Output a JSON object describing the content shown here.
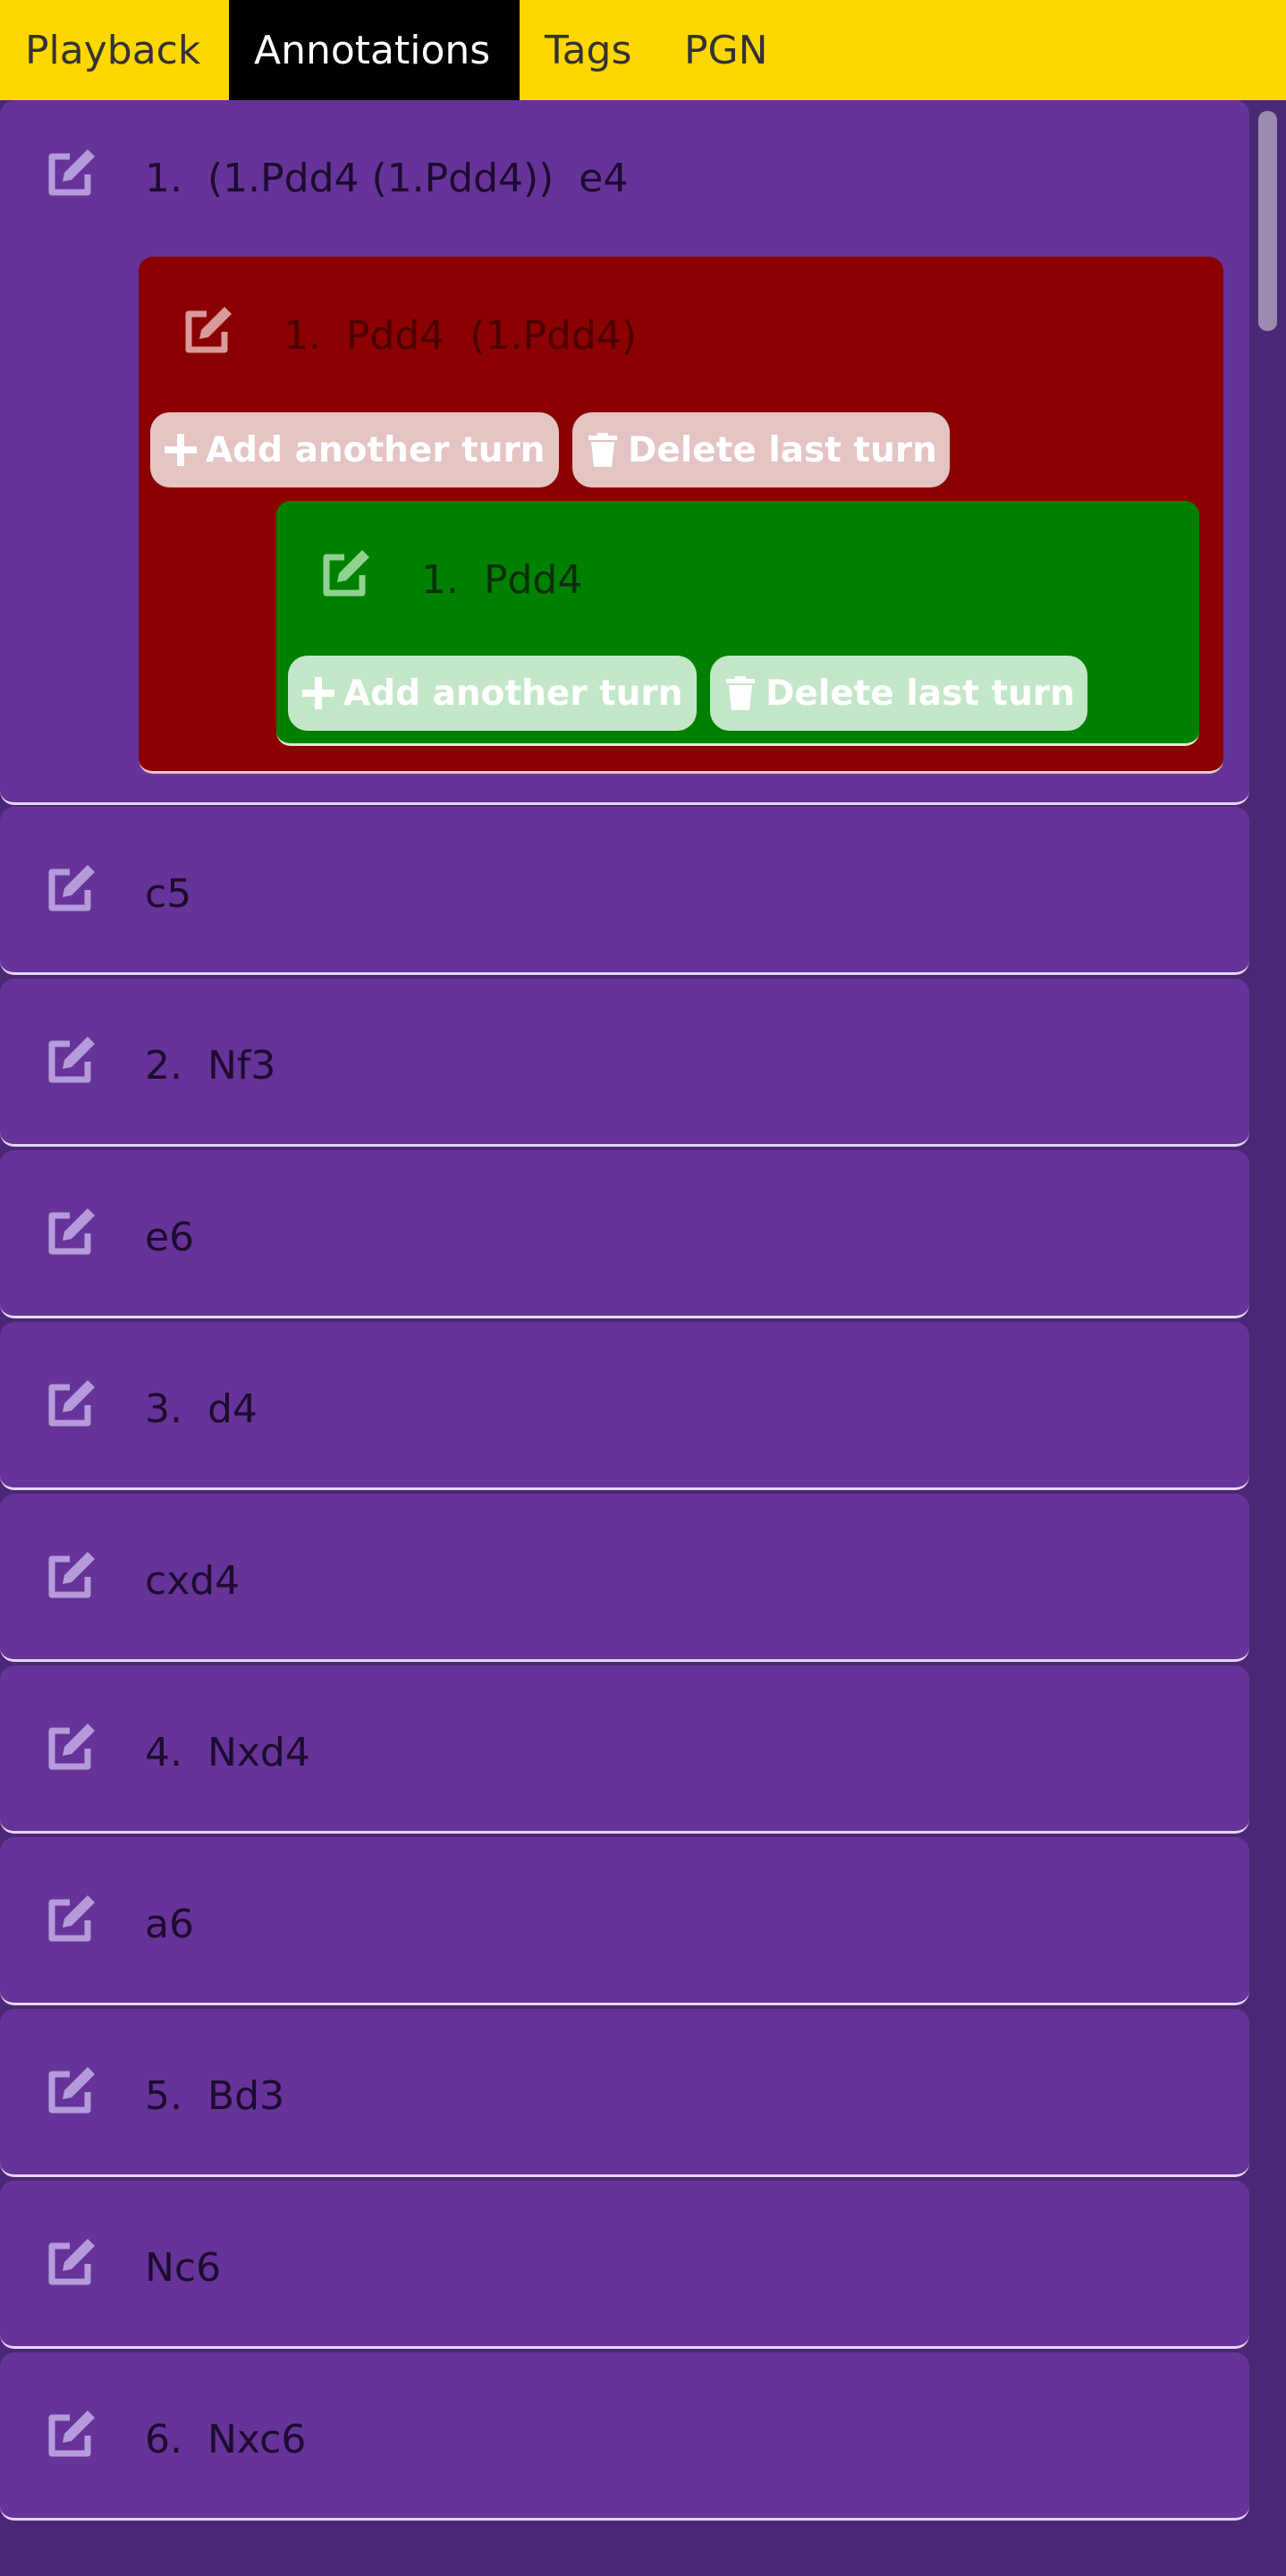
{
  "tabs": [
    {
      "label": "Playback",
      "active": false
    },
    {
      "label": "Annotations",
      "active": true
    },
    {
      "label": "Tags",
      "active": false
    },
    {
      "label": "PGN",
      "active": false
    }
  ],
  "colors": {
    "tab_bar": "#ffd700",
    "tab_active_bg": "#000000",
    "move_row": "#663399",
    "variation_level_1": "#8b0000",
    "variation_level_2": "#008000",
    "page_bg": "#4b2875"
  },
  "icons": {
    "edit": "edit-icon",
    "add": "plus-icon",
    "delete": "trash-icon"
  },
  "moves": {
    "first": {
      "text": "1.  (1.Pdd4 (1.Pdd4))  e4",
      "variation": {
        "text": "1.  Pdd4  (1.Pdd4)",
        "add_label": "Add another turn",
        "delete_label": "Delete last turn",
        "variation": {
          "text": "1.  Pdd4",
          "add_label": "Add another turn",
          "delete_label": "Delete last turn"
        }
      }
    },
    "rows": [
      {
        "text": "c5"
      },
      {
        "text": "2.  Nf3"
      },
      {
        "text": "e6"
      },
      {
        "text": "3.  d4"
      },
      {
        "text": "cxd4"
      },
      {
        "text": "4.  Nxd4"
      },
      {
        "text": "a6"
      },
      {
        "text": "5.  Bd3"
      },
      {
        "text": "Nc6"
      },
      {
        "text": "6.  Nxc6"
      }
    ]
  }
}
